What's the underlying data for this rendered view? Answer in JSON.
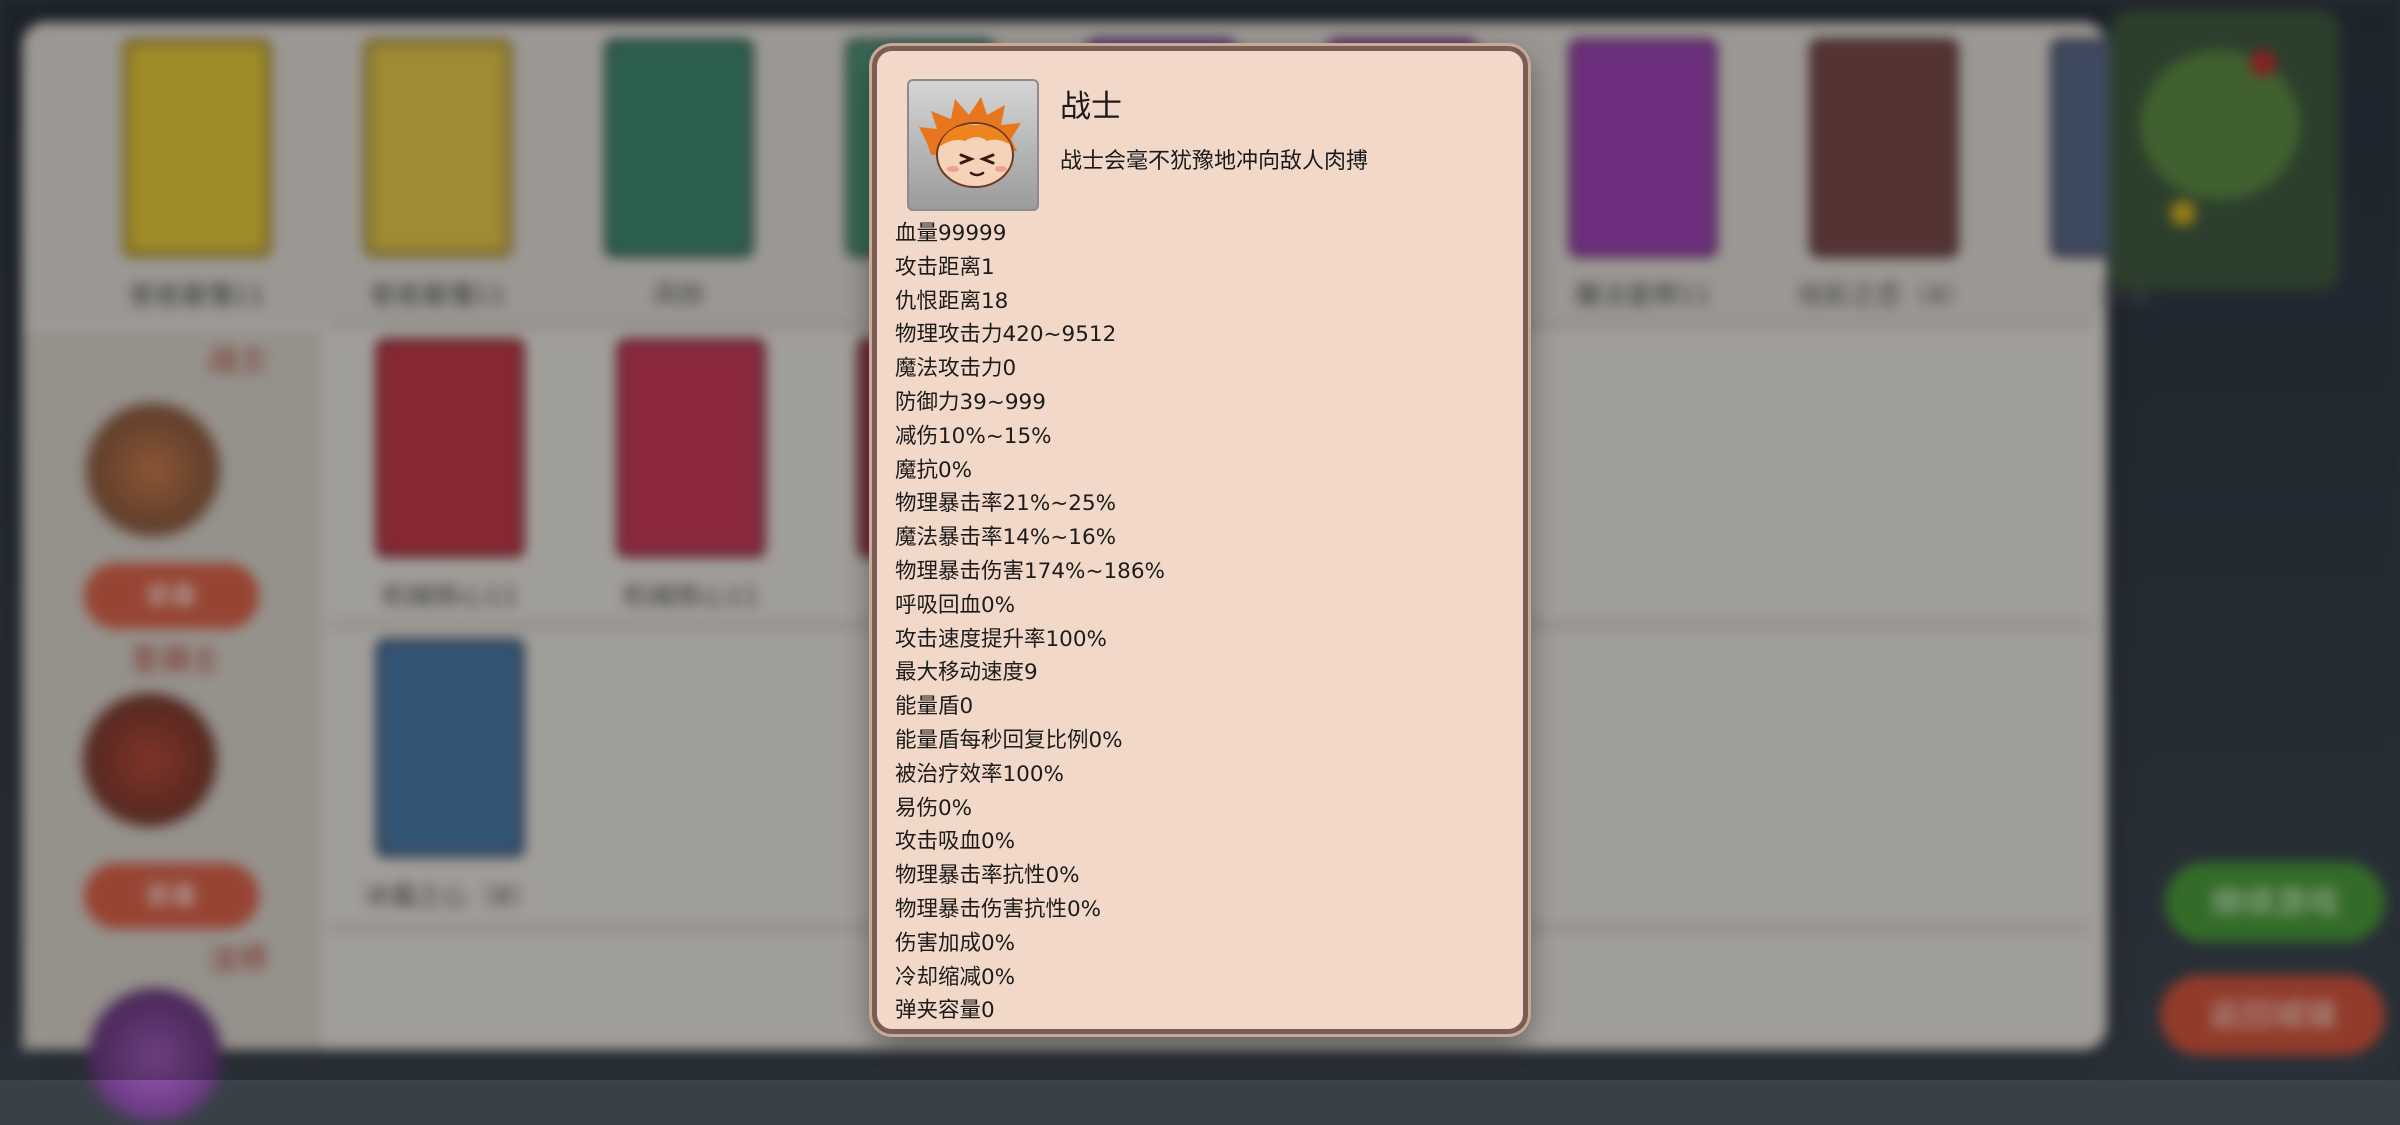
{
  "background": {
    "top_cards": [
      {
        "label": "爸爸最懂11",
        "color": "#e4c93a"
      },
      {
        "label": "爸爸最懂11",
        "color": "#e2c74a"
      },
      {
        "label": "风铃",
        "color": "#3f8a74"
      },
      {
        "label": "",
        "color": "#4f9a7a"
      },
      {
        "label": "",
        "color": "#8a58b8"
      },
      {
        "label": "",
        "color": "#9a4aa8"
      },
      {
        "label": "魔法星辉11",
        "color": "#9c44b4"
      },
      {
        "label": "炫彩之恋（4）",
        "color": "#7a4a4a"
      },
      {
        "label": "冰晶",
        "color": "#5a6a8a"
      }
    ],
    "row2_cards": [
      {
        "label": "机械核心11",
        "color": "#c23a4a"
      },
      {
        "label": "机械核心11",
        "color": "#c83a5a"
      },
      {
        "label": "",
        "color": "#b04050"
      }
    ],
    "row3_cards": [
      {
        "label": "冰霜之心（8）",
        "color": "#4a7aa8"
      }
    ],
    "categories": [
      "战士",
      "圣骑士",
      "法师"
    ],
    "hero_buttons": [
      "装备",
      "装备"
    ],
    "continue_button": "继续游戏",
    "return_button": "返回城镇"
  },
  "unit": {
    "name": "战士",
    "description": "战士会毫不犹豫地冲向敌人肉搏",
    "portrait_icon": "warrior-face-icon"
  },
  "stats": [
    "血量99999",
    "攻击距离1",
    "仇恨距离18",
    "物理攻击力420~9512",
    "魔法攻击力0",
    "防御力39~999",
    "减伤10%~15%",
    "魔抗0%",
    "物理暴击率21%~25%",
    "魔法暴击率14%~16%",
    "物理暴击伤害174%~186%",
    "呼吸回血0%",
    "攻击速度提升率100%",
    "最大移动速度9",
    "能量盾0",
    "能量盾每秒回复比例0%",
    "被治疗效率100%",
    "易伤0%",
    "攻击吸血0%",
    "物理暴击率抗性0%",
    "物理暴击伤害抗性0%",
    "伤害加成0%",
    "冷却缩减0%",
    "弹夹容量0"
  ],
  "colors": {
    "dialog_bg": "#f2d8c8",
    "dialog_border": "#7a5d55"
  }
}
